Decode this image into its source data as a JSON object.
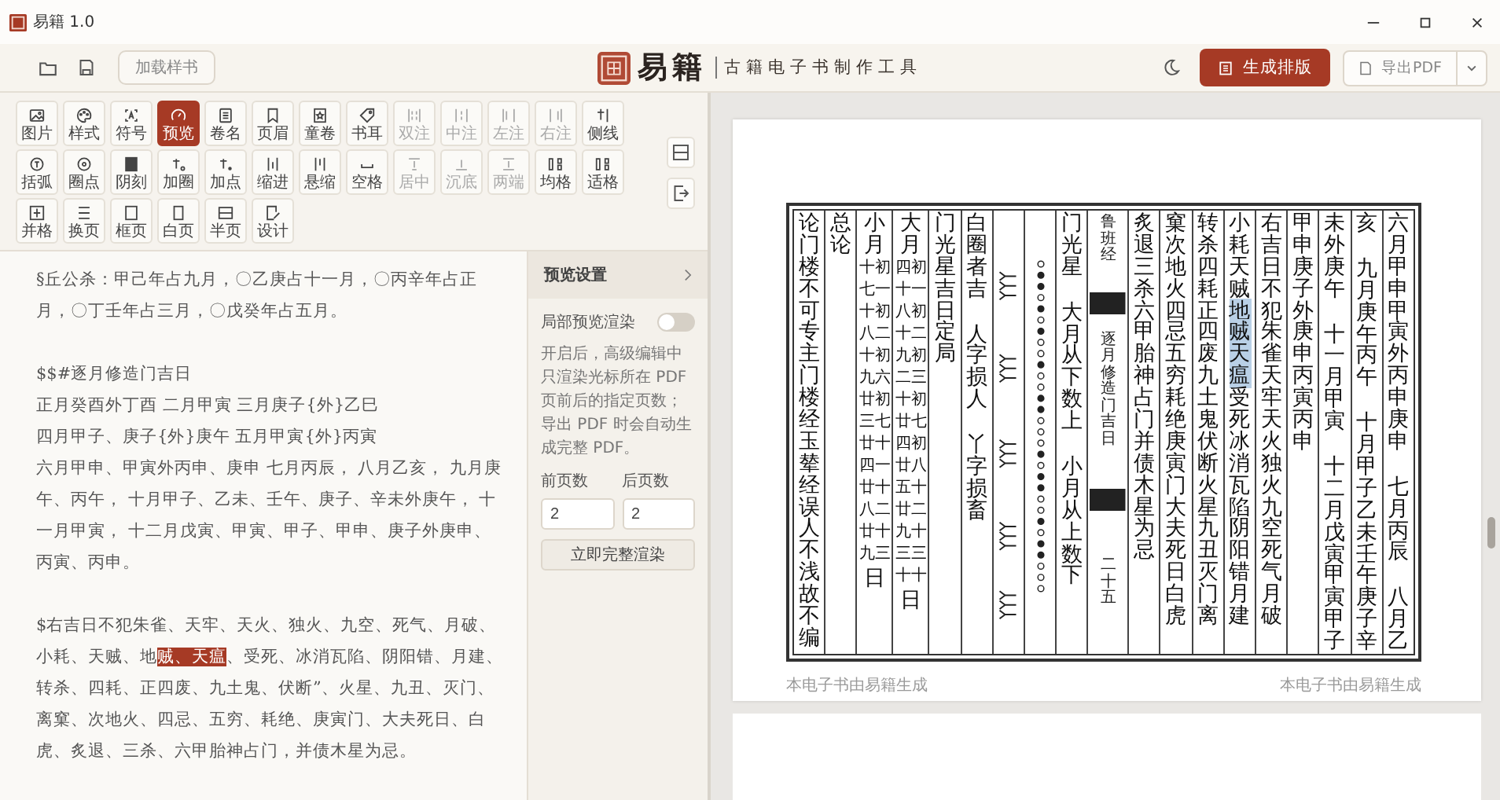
{
  "window": {
    "title": "易籍 1.0"
  },
  "header": {
    "load_button": "加载样书",
    "brand": "易籍",
    "subtitle": "古籍电子书制作工具",
    "generate_button": "生成排版",
    "export_button": "导出PDF"
  },
  "tool_rows": [
    [
      {
        "label": "图片",
        "selected": false,
        "disabled": false
      },
      {
        "label": "样式",
        "selected": false,
        "disabled": false
      },
      {
        "label": "符号",
        "selected": false,
        "disabled": false
      },
      {
        "label": "预览",
        "selected": true,
        "disabled": false
      },
      {
        "label": "卷名",
        "selected": false,
        "disabled": false
      },
      {
        "label": "页眉",
        "selected": false,
        "disabled": false
      },
      {
        "label": "童卷",
        "selected": false,
        "disabled": false
      },
      {
        "label": "书耳",
        "selected": false,
        "disabled": false
      },
      {
        "label": "双注",
        "selected": false,
        "disabled": true
      },
      {
        "label": "中注",
        "selected": false,
        "disabled": true
      },
      {
        "label": "左注",
        "selected": false,
        "disabled": true
      },
      {
        "label": "右注",
        "selected": false,
        "disabled": true
      },
      {
        "label": "侧线",
        "selected": false,
        "disabled": false
      }
    ],
    [
      {
        "label": "括弧",
        "selected": false,
        "disabled": false
      },
      {
        "label": "圈点",
        "selected": false,
        "disabled": false
      },
      {
        "label": "阴刻",
        "selected": false,
        "disabled": false
      },
      {
        "label": "加圈",
        "selected": false,
        "disabled": false
      },
      {
        "label": "加点",
        "selected": false,
        "disabled": false
      },
      {
        "label": "缩进",
        "selected": false,
        "disabled": false
      },
      {
        "label": "悬缩",
        "selected": false,
        "disabled": false
      },
      {
        "label": "空格",
        "selected": false,
        "disabled": false
      },
      {
        "label": "居中",
        "selected": false,
        "disabled": true
      },
      {
        "label": "沉底",
        "selected": false,
        "disabled": true
      },
      {
        "label": "两端",
        "selected": false,
        "disabled": true
      },
      {
        "label": "均格",
        "selected": false,
        "disabled": false
      },
      {
        "label": "适格",
        "selected": false,
        "disabled": false
      }
    ],
    [
      {
        "label": "并格",
        "selected": false,
        "disabled": false
      },
      {
        "label": "换页",
        "selected": false,
        "disabled": false
      },
      {
        "label": "框页",
        "selected": false,
        "disabled": false
      },
      {
        "label": "白页",
        "selected": false,
        "disabled": false
      },
      {
        "label": "半页",
        "selected": false,
        "disabled": false
      },
      {
        "label": "设计",
        "selected": false,
        "disabled": false
      }
    ]
  ],
  "editor": {
    "blocks": [
      {
        "lines": [
          {
            "text": "§丘公杀：甲己年占九月，〇乙庚占十一月，〇丙辛年占正月，〇丁壬年占三月，〇戊癸年占五月。"
          }
        ]
      },
      {
        "lines": [
          {
            "text": "$$#逐月修造门吉日"
          },
          {
            "text": "正月癸酉外丁酉 二月甲寅 三月庚子{外}乙巳"
          },
          {
            "text": "四月甲子、庚子{外}庚午 五月甲寅{外}丙寅"
          },
          {
            "text": "六月甲申、甲寅外丙申、庚申 七月丙辰， 八月乙亥， 九月庚午、丙午， 十月甲子、乙未、壬午、庚子、辛未外庚午， 十一月甲寅， 十二月戊寅、甲寅、甲子、甲申、庚子外庚申、丙寅、丙申。"
          }
        ]
      },
      {
        "lines": [
          {
            "segments": [
              {
                "text": "$右吉日不犯朱雀、天牢、天火、独火、九空、死气、月破、小耗、天贼、地",
                "highlighted": false
              },
              {
                "text": "贼、天瘟",
                "highlighted": true
              },
              {
                "text": "、受死、冰消瓦陷、阴阳错、月建、转杀、四耗、正四废、九土鬼、伏断”、火星、九丑、灭门、离窠、次地火、四忌、五穷、耗绝、庚寅门、大夫死日、白虎、炙退、三杀、六甲胎神占门，并债木星为忌。",
                "highlighted": false
              }
            ]
          }
        ]
      }
    ]
  },
  "preview_settings": {
    "title": "预览设置",
    "partial_render": {
      "label": "局部预览渲染",
      "on": false
    },
    "description": "开启后，高级编辑中只渲染光标所在 PDF 页前后的指定页数；导出 PDF 时会自动生成完整 PDF。",
    "before": {
      "label": "前页数",
      "value": "2"
    },
    "after": {
      "label": "后页数",
      "value": "2"
    },
    "render_button": "立即完整渲染"
  },
  "page": {
    "columns": [
      {
        "kind": "text",
        "parts": [
          "论门楼不可专主门楼经玉辇经误人不浅故不编"
        ]
      },
      {
        "kind": "text",
        "parts": [
          "总论"
        ]
      },
      {
        "kind": "grid",
        "header": "小月",
        "rows": [
          "十初",
          "七一",
          "十初",
          "八二",
          "十初",
          "九六",
          "廿初",
          "三七",
          "廿十",
          "四一",
          "廿十",
          "八二",
          "廿十",
          "九三"
        ],
        "tail": "日"
      },
      {
        "kind": "grid",
        "header": "大月",
        "rows": [
          "四初",
          "十一",
          "八初",
          "十二",
          "九初",
          "二三",
          "十初",
          "廿七",
          "四初",
          "廿八",
          "五十",
          "廿二",
          "九十",
          "三三",
          "十十"
        ],
        "tail": "日"
      },
      {
        "kind": "text",
        "parts": [
          "门光星吉日定局"
        ]
      },
      {
        "kind": "text",
        "parts": [
          "白圈者吉",
          "人字损人",
          "丫字损畜"
        ]
      },
      {
        "kind": "marks"
      },
      {
        "kind": "dots"
      },
      {
        "kind": "text",
        "parts": [
          "门光星",
          "大月从下数上",
          "小月从上数下"
        ]
      },
      {
        "kind": "center",
        "top": "鲁班经",
        "title": "逐月修造门吉日",
        "number": "二十五"
      },
      {
        "kind": "text",
        "parts": [
          "炙退三杀六甲胎神占门并债木星为忌"
        ]
      },
      {
        "kind": "text",
        "parts": [
          "窠次地火四忌五穷耗绝庚寅门大夫死日白虎"
        ]
      },
      {
        "kind": "text",
        "parts": [
          "转杀四耗正四废九土鬼伏断火星九丑灭门离"
        ]
      },
      {
        "kind": "text",
        "segments": [
          {
            "text": "小耗天贼",
            "highlighted": false
          },
          {
            "text": "地贼天瘟",
            "highlighted": true
          },
          {
            "text": "受死冰消瓦陷阴阳错月建",
            "highlighted": false
          }
        ]
      },
      {
        "kind": "text",
        "parts": [
          "右吉日不犯朱雀天牢天火独火九空死气月破"
        ]
      },
      {
        "kind": "text",
        "parts": [
          "甲申庚子外庚申丙寅丙申"
        ]
      },
      {
        "kind": "text",
        "parts": [
          "未外庚午",
          "十一月甲寅",
          "十二月戊寅甲寅甲子"
        ]
      },
      {
        "kind": "text",
        "parts": [
          "亥",
          "九月庚午丙午",
          "十月甲子乙未壬午庚子辛"
        ]
      },
      {
        "kind": "text",
        "parts": [
          "六月甲申甲寅外丙申庚申",
          "七月丙辰",
          "八月乙"
        ]
      }
    ],
    "footer_left": "本电子书由易籍生成",
    "footer_right": "本电子书由易籍生成"
  }
}
